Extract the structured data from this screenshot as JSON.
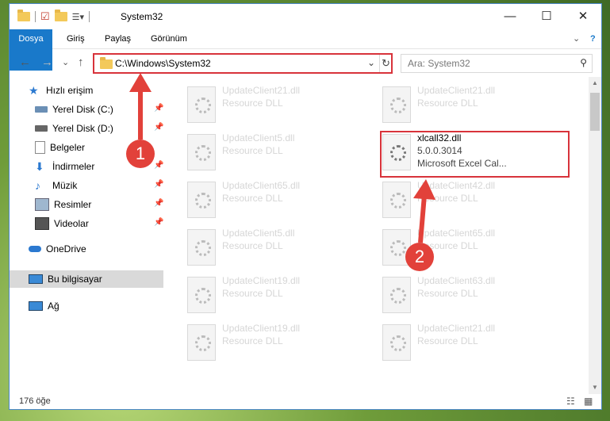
{
  "window": {
    "title": "System32",
    "minimize_label": "—",
    "maximize_label": "☐",
    "close_label": "✕"
  },
  "ribbon": {
    "tabs": [
      "Dosya",
      "Giriş",
      "Paylaş",
      "Görünüm"
    ],
    "expand_label": "⌄",
    "help_label": "?"
  },
  "nav": {
    "back_label": "←",
    "forward_label": "→",
    "recent_label": "⌄",
    "up_label": "↑",
    "address": "C:\\Windows\\System32",
    "search_placeholder": "Ara: System32"
  },
  "sidebar": {
    "items": [
      {
        "label": "Hızlı erişim",
        "icon": "star-icon"
      },
      {
        "label": "Yerel Disk (C:)",
        "icon": "drive-icon"
      },
      {
        "label": "Yerel Disk (D:)",
        "icon": "drive-icon"
      },
      {
        "label": "Belgeler",
        "icon": "documents-icon"
      },
      {
        "label": "İndirmeler",
        "icon": "downloads-icon"
      },
      {
        "label": "Müzik",
        "icon": "music-icon"
      },
      {
        "label": "Resimler",
        "icon": "pictures-icon"
      },
      {
        "label": "Videolar",
        "icon": "videos-icon"
      },
      {
        "label": "OneDrive",
        "icon": "cloud-icon"
      },
      {
        "label": "Bu bilgisayar",
        "icon": "computer-icon"
      },
      {
        "label": "Ağ",
        "icon": "network-icon"
      }
    ]
  },
  "files": [
    {
      "name": "UpdateClient21.dll",
      "desc": "Resource DLL"
    },
    {
      "name": "UpdateClient21.dll",
      "desc": "Resource DLL"
    },
    {
      "name": "UpdateClient5.dll",
      "desc": "Resource DLL"
    },
    {
      "name": "xlcall32.dll",
      "desc": "5.0.0.3014",
      "extra": "Microsoft Excel Cal..."
    },
    {
      "name": "UpdateClient65.dll",
      "desc": "Resource DLL"
    },
    {
      "name": "UpdateClient42.dll",
      "desc": "Resource DLL"
    },
    {
      "name": "UpdateClient5.dll",
      "desc": "Resource DLL"
    },
    {
      "name": "UpdateClient65.dll",
      "desc": "Resource DLL"
    },
    {
      "name": "UpdateClient19.dll",
      "desc": "Resource DLL"
    },
    {
      "name": "UpdateClient63.dll",
      "desc": "Resource DLL"
    },
    {
      "name": "UpdateClient19.dll",
      "desc": "Resource DLL"
    },
    {
      "name": "UpdateClient21.dll",
      "desc": "Resource DLL"
    }
  ],
  "status": {
    "count": "176 öğe"
  },
  "annotations": {
    "step1": "1",
    "step2": "2"
  },
  "colors": {
    "accent": "#1979ca",
    "annotation": "#e2413a"
  }
}
